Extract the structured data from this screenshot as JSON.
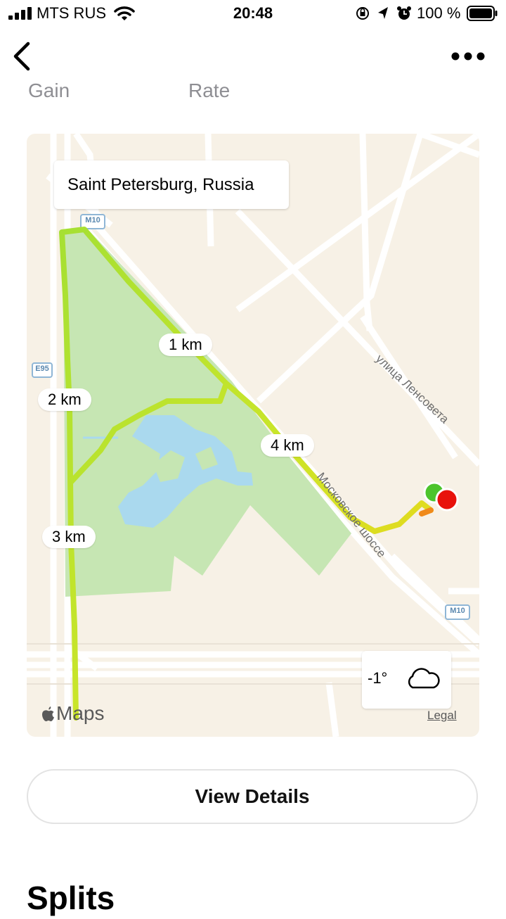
{
  "status_bar": {
    "carrier": "MTS RUS",
    "time": "20:48",
    "battery_percent": "100 %",
    "icons": [
      "signal-icon",
      "wifi-icon",
      "orientation-lock-icon",
      "location-arrow-icon",
      "alarm-icon",
      "battery-icon"
    ]
  },
  "nav": {
    "back_icon": "chevron-left-icon",
    "more_icon": "ellipsis-icon"
  },
  "peek_labels": [
    "Gain",
    "Rate"
  ],
  "map": {
    "location_name": "Saint Petersburg, Russia",
    "km_markers": [
      "1 km",
      "2 km",
      "3 km",
      "4 km"
    ],
    "road_shields": [
      "M10",
      "E95",
      "M10"
    ],
    "street_names": [
      "улица Ленсовета",
      "Московское шоссе"
    ],
    "attribution": "Maps",
    "legal": "Legal",
    "weather": {
      "temperature": "-1°",
      "condition_icon": "cloud-icon"
    },
    "colors": {
      "route_start": "#8fd14f",
      "route_end": "#f2d416",
      "start_marker": "#4cc42c",
      "end_marker": "#e8120c",
      "park": "#c6e6b3",
      "water": "#aad9ee"
    }
  },
  "actions": {
    "view_details": "View Details"
  },
  "sections": {
    "splits_heading": "Splits"
  }
}
